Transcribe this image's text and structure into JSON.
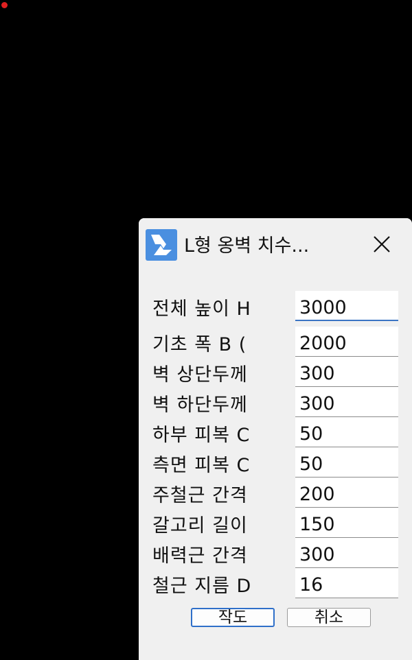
{
  "dialog": {
    "title": "L형 옹벽 치수...",
    "icon": "bricscad-logo-icon",
    "close_icon": "close-icon",
    "accent_color": "#2e6fc9"
  },
  "fields": [
    {
      "label": "전체 높이 H",
      "value": "3000"
    },
    {
      "label": "기초 폭 B (",
      "value": "2000"
    },
    {
      "label": "벽 상단두께",
      "value": "300"
    },
    {
      "label": "벽 하단두께",
      "value": "300"
    },
    {
      "label": "하부 피복 C",
      "value": "50"
    },
    {
      "label": "측면 피복 C",
      "value": "50"
    },
    {
      "label": "주철근 간격",
      "value": "200"
    },
    {
      "label": "갈고리 길이",
      "value": "150"
    },
    {
      "label": "배력근 간격",
      "value": "300"
    },
    {
      "label": "철근 지름 D",
      "value": "16"
    }
  ],
  "buttons": {
    "ok_label": "작도",
    "cancel_label": "취소"
  }
}
